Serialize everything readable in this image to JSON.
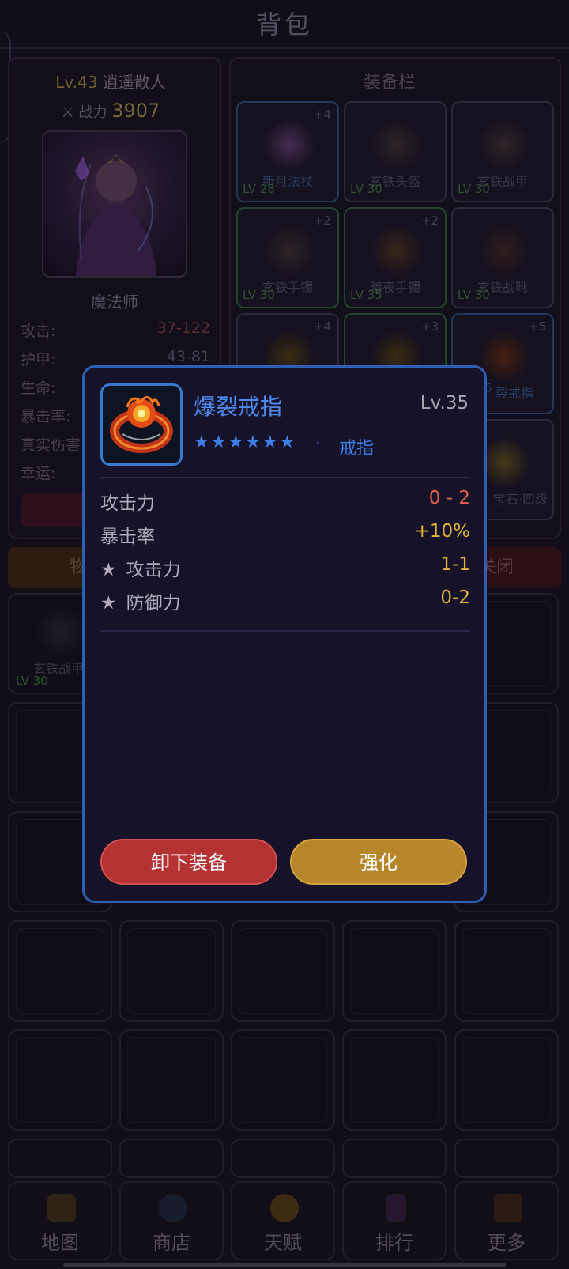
{
  "header": {
    "title": "背包"
  },
  "character": {
    "level": "Lv.43",
    "name": "逍遥散人",
    "power_label": "战力",
    "power_value": "3907",
    "class_name": "魔法师",
    "stats": [
      {
        "label": "攻击:",
        "value": "37-122"
      },
      {
        "label": "护甲:",
        "value": "43-81"
      },
      {
        "label": "生命:",
        "value": ""
      },
      {
        "label": "暴击率:",
        "value": ""
      },
      {
        "label": "真实伤害",
        "value": ""
      },
      {
        "label": "幸运:",
        "value": ""
      }
    ]
  },
  "equipment": {
    "title": "装备栏",
    "slots": [
      {
        "name": "新月法杖",
        "level": "LV 28",
        "plus": "+4"
      },
      {
        "name": "玄铁头盔",
        "level": "LV 30",
        "plus": ""
      },
      {
        "name": "玄铁战甲",
        "level": "LV 30",
        "plus": ""
      },
      {
        "name": "玄铁手镯",
        "level": "LV 30",
        "plus": "+2"
      },
      {
        "name": "暗夜手镯",
        "level": "LV 35",
        "plus": "+2"
      },
      {
        "name": "玄铁战靴",
        "level": "LV 30",
        "plus": ""
      },
      {
        "name": "",
        "level": "",
        "plus": "+4"
      },
      {
        "name": "",
        "level": "",
        "plus": "+3"
      },
      {
        "name": "裂戒指",
        "level": "5",
        "plus": "+5"
      },
      {
        "name": "宝石·四级",
        "level": "",
        "plus": ""
      }
    ]
  },
  "tabs": {
    "items": "物品",
    "close": "关闭"
  },
  "bag": {
    "first_item": {
      "name": "玄铁战甲",
      "level": "LV 30"
    }
  },
  "nav": [
    {
      "label": "地图",
      "icon": "map-icon"
    },
    {
      "label": "商店",
      "icon": "shop-icon"
    },
    {
      "label": "天赋",
      "icon": "talent-icon"
    },
    {
      "label": "排行",
      "icon": "rank-icon"
    },
    {
      "label": "更多",
      "icon": "more-icon"
    }
  ],
  "modal": {
    "item_name": "爆裂戒指",
    "item_level": "Lv.35",
    "stars": "★★★★★★",
    "separator": "·",
    "item_type": "戒指",
    "attributes": [
      {
        "label": "攻击力",
        "value": "0 - 2",
        "starred": false
      },
      {
        "label": "暴击率",
        "value": "+10%",
        "starred": false
      },
      {
        "label": "攻击力",
        "value": "1-1",
        "starred": true
      },
      {
        "label": "防御力",
        "value": "0-2",
        "starred": true
      }
    ],
    "unequip_label": "卸下装备",
    "enhance_label": "强化"
  },
  "colors": {
    "modal_border": "#2f5fb5",
    "item_name": "#4d8bf0",
    "value_red": "#e4604c",
    "value_gold": "#e2b43a",
    "btn_red": "#b53232",
    "btn_gold": "#b8862a"
  }
}
